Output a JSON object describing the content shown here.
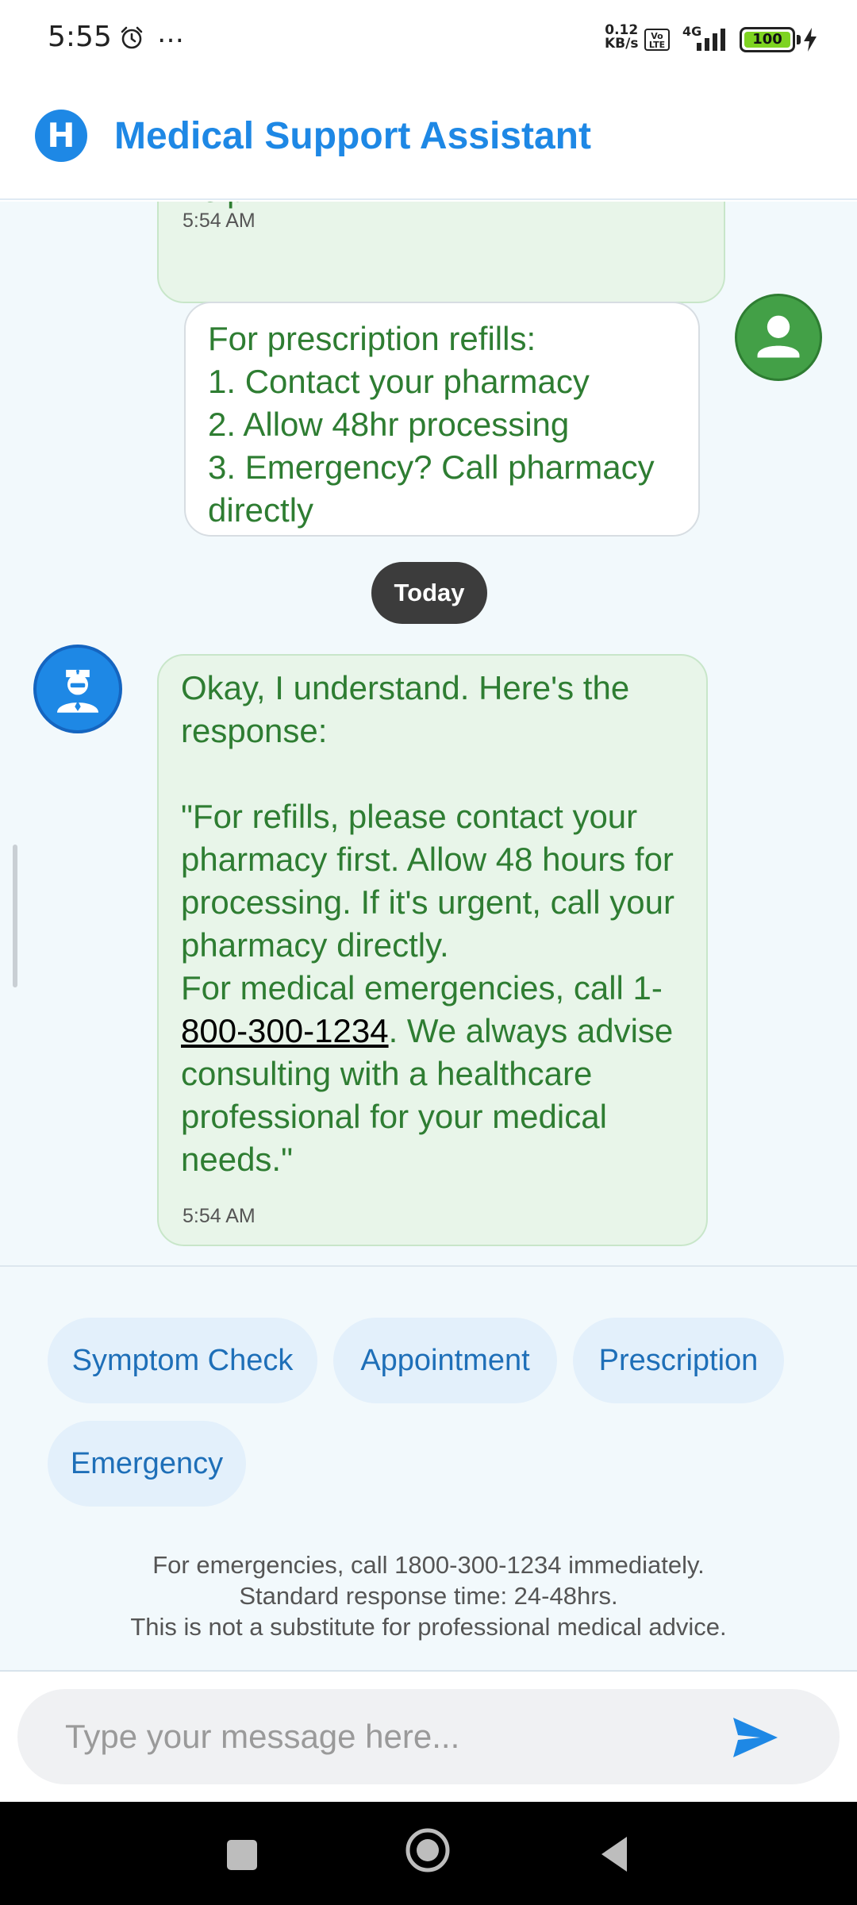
{
  "status_bar": {
    "time": "5:55",
    "more": "…",
    "net_speed_value": "0.12",
    "net_speed_unit": "KB/s",
    "volte": "Vo LTE",
    "network": "4G",
    "battery": "100"
  },
  "header": {
    "logo_letter": "H",
    "title": "Medical Support Assistant"
  },
  "messages": {
    "previous": {
      "text_fragment": "help?",
      "time": "5:54 AM"
    },
    "user": {
      "text": "For prescription refills:\n1. Contact your pharmacy\n2. Allow 48hr processing\n3. Emergency? Call pharmacy directly"
    },
    "date_divider": "Today",
    "bot": {
      "text_before": "Okay, I understand. Here's the response:\n\n\"For refills, please contact your pharmacy first. Allow 48 hours for processing. If it's urgent, call your pharmacy directly.\nFor medical emergencies, call 1-",
      "phone": "800-300-1234",
      "text_after": ". We always advise consulting with a healthcare professional for your medical needs.\"",
      "time": "5:54 AM"
    }
  },
  "quick_replies": [
    "Symptom Check",
    "Appointment",
    "Prescription",
    "Emergency"
  ],
  "disclaimer": {
    "line1": "For emergencies, call 1800-300-1234 immediately.",
    "line2": "Standard response time: 24-48hrs.",
    "line3": "This is not a substitute for professional medical advice."
  },
  "input": {
    "placeholder": "Type your message here...",
    "value": ""
  },
  "icons": {
    "alarm": "alarm-clock-icon",
    "signal": "signal-bars-icon",
    "battery": "battery-icon",
    "charging": "charging-bolt-icon",
    "user_avatar": "person-icon",
    "bot_avatar": "doctor-icon",
    "send": "send-arrow-icon",
    "nav_recents": "square-icon",
    "nav_home": "circle-home-icon",
    "nav_back": "triangle-back-icon"
  },
  "colors": {
    "accent": "#1e88e5",
    "bubble_text": "#2e7d32",
    "bot_bubble_bg": "#e8f5e9",
    "chat_bg": "#f2f9fc",
    "user_avatar_bg": "#43a047",
    "chip_bg": "#e3f0fb",
    "chip_text": "#1e6fb8"
  }
}
